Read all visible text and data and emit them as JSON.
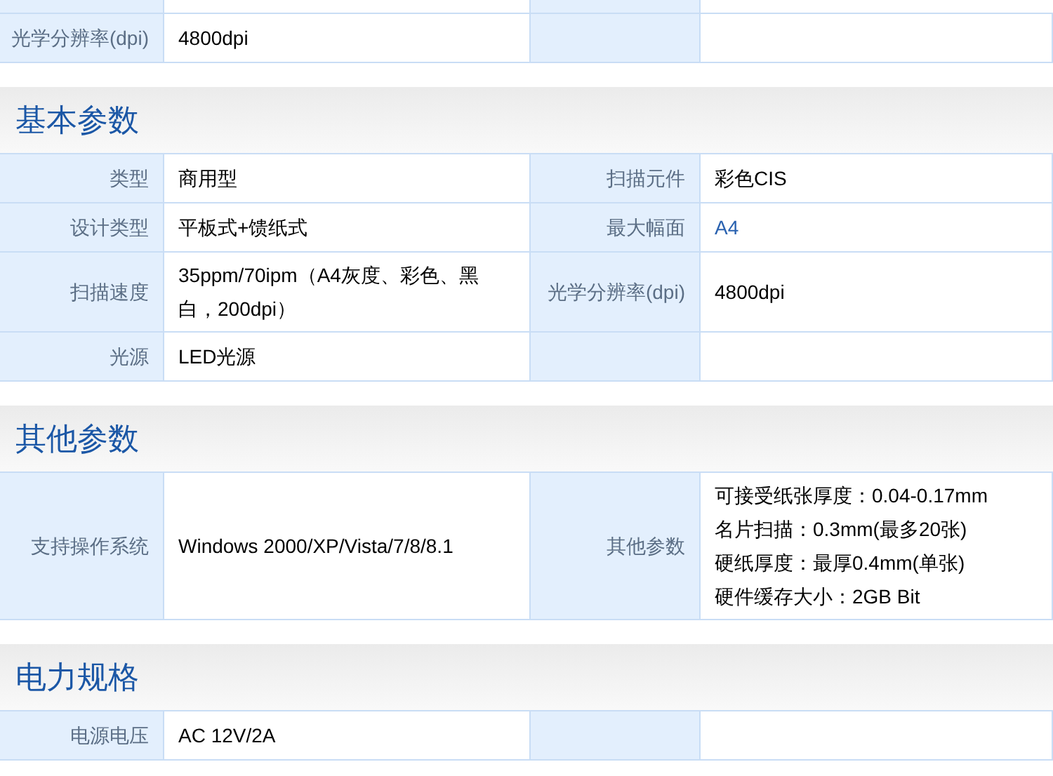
{
  "sections": [
    {
      "rows": [
        {
          "cells": [
            {
              "label": "光学分辨率(dpi)",
              "value": "4800dpi"
            },
            {}
          ]
        }
      ]
    },
    {
      "title": "基本参数",
      "rows": [
        {
          "cells": [
            {
              "label": "类型",
              "value": "商用型"
            },
            {
              "label": "扫描元件",
              "value": "彩色CIS"
            }
          ]
        },
        {
          "cells": [
            {
              "label": "设计类型",
              "value": "平板式+馈纸式"
            },
            {
              "label": "最大幅面",
              "value": "A4",
              "link": true
            }
          ]
        },
        {
          "cells": [
            {
              "label": "扫描速度",
              "value": "35ppm/70ipm（A4灰度、彩色、黑白，200dpi）"
            },
            {
              "label": "光学分辨率(dpi)",
              "value": "4800dpi"
            }
          ]
        },
        {
          "cells": [
            {
              "label": "光源",
              "value": "LED光源"
            },
            {}
          ]
        }
      ]
    },
    {
      "title": "其他参数",
      "rows": [
        {
          "cells": [
            {
              "label": "支持操作系统",
              "value": "Windows 2000/XP/Vista/7/8/8.1"
            },
            {
              "label": "其他参数",
              "lines": [
                "可接受纸张厚度：0.04-0.17mm",
                "名片扫描：0.3mm(最多20张)",
                "硬纸厚度：最厚0.4mm(单张)",
                "硬件缓存大小：2GB Bit"
              ]
            }
          ]
        }
      ]
    },
    {
      "title": "电力规格",
      "rows": [
        {
          "cells": [
            {
              "label": "电源电压",
              "value": "AC 12V/2A"
            },
            {}
          ]
        }
      ]
    }
  ]
}
